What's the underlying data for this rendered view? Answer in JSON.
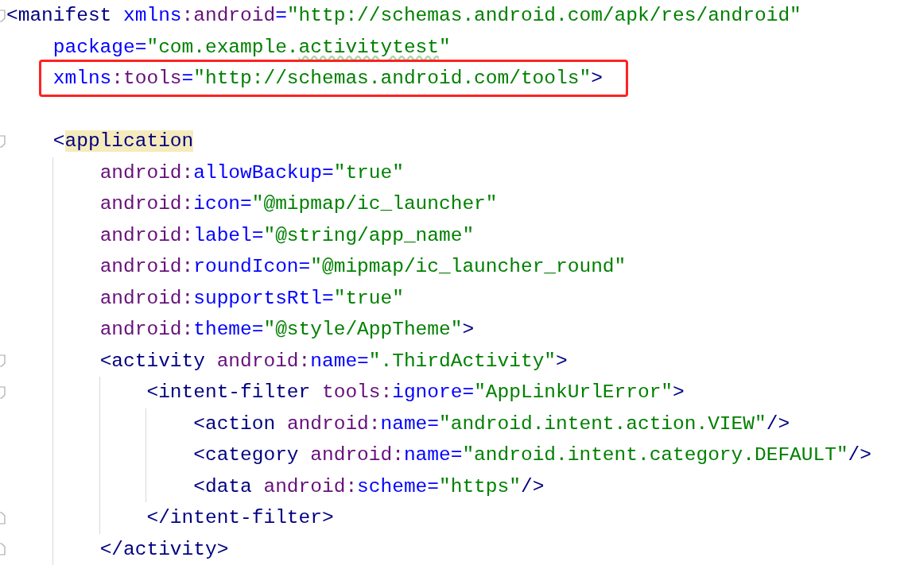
{
  "editor": {
    "lines": [
      {
        "kind": "fold-start",
        "tokens": [
          {
            "kind": "tag",
            "text": "<manifest "
          },
          {
            "kind": "attr",
            "text": "xmlns"
          },
          {
            "kind": "ns",
            "text": ":android"
          },
          {
            "kind": "attr",
            "text": "="
          },
          {
            "kind": "value",
            "text": "\"http://schemas.android.com/apk/res/android\""
          }
        ],
        "children": [
          {
            "kind": "plain",
            "tokens": [
              {
                "kind": "attr",
                "text": "package"
              },
              {
                "kind": "attr",
                "text": "="
              },
              {
                "kind": "value",
                "text": "\"com.example."
              },
              {
                "kind": "value",
                "text": "activitytest",
                "typo": true
              },
              {
                "kind": "value",
                "text": "\""
              }
            ]
          },
          {
            "kind": "plain",
            "boxed": true,
            "tokens": [
              {
                "kind": "attr",
                "text": "xmlns"
              },
              {
                "kind": "ns",
                "text": ":tools"
              },
              {
                "kind": "attr",
                "text": "="
              },
              {
                "kind": "value",
                "text": "\"http://schemas.android.com/tools\""
              },
              {
                "kind": "tag",
                "text": ">"
              }
            ]
          },
          {
            "kind": "blank"
          },
          {
            "kind": "fold-start",
            "tokens": [
              {
                "kind": "tag",
                "text": "<"
              },
              {
                "kind": "tag",
                "text": "application",
                "highlighted": true
              }
            ],
            "children": [
              {
                "kind": "plain",
                "tokens": [
                  {
                    "kind": "ns",
                    "text": "android:"
                  },
                  {
                    "kind": "attr",
                    "text": "allowBackup="
                  },
                  {
                    "kind": "value",
                    "text": "\"true\""
                  }
                ]
              },
              {
                "kind": "plain",
                "tokens": [
                  {
                    "kind": "ns",
                    "text": "android:"
                  },
                  {
                    "kind": "attr",
                    "text": "icon="
                  },
                  {
                    "kind": "value",
                    "text": "\"@mipmap/ic_launcher\""
                  }
                ]
              },
              {
                "kind": "plain",
                "tokens": [
                  {
                    "kind": "ns",
                    "text": "android:"
                  },
                  {
                    "kind": "attr",
                    "text": "label="
                  },
                  {
                    "kind": "value",
                    "text": "\"@string/app_name\""
                  }
                ]
              },
              {
                "kind": "plain",
                "tokens": [
                  {
                    "kind": "ns",
                    "text": "android:"
                  },
                  {
                    "kind": "attr",
                    "text": "roundIcon="
                  },
                  {
                    "kind": "value",
                    "text": "\"@mipmap/ic_launcher_round\""
                  }
                ]
              },
              {
                "kind": "plain",
                "tokens": [
                  {
                    "kind": "ns",
                    "text": "android:"
                  },
                  {
                    "kind": "attr",
                    "text": "supportsRtl="
                  },
                  {
                    "kind": "value",
                    "text": "\"true\""
                  }
                ]
              },
              {
                "kind": "plain",
                "tokens": [
                  {
                    "kind": "ns",
                    "text": "android:"
                  },
                  {
                    "kind": "attr",
                    "text": "theme="
                  },
                  {
                    "kind": "value",
                    "text": "\"@style/AppTheme\""
                  },
                  {
                    "kind": "tag",
                    "text": ">"
                  }
                ]
              },
              {
                "kind": "fold-start",
                "tokens": [
                  {
                    "kind": "tag",
                    "text": "<activity "
                  },
                  {
                    "kind": "ns",
                    "text": "android:"
                  },
                  {
                    "kind": "attr",
                    "text": "name="
                  },
                  {
                    "kind": "value",
                    "text": "\".ThirdActivity\""
                  },
                  {
                    "kind": "tag",
                    "text": ">"
                  }
                ],
                "children": [
                  {
                    "kind": "fold-start",
                    "tokens": [
                      {
                        "kind": "tag",
                        "text": "<intent-filter "
                      },
                      {
                        "kind": "ns",
                        "text": "tools:"
                      },
                      {
                        "kind": "attr",
                        "text": "ignore="
                      },
                      {
                        "kind": "value",
                        "text": "\"AppLinkUrlError\""
                      },
                      {
                        "kind": "tag",
                        "text": ">"
                      }
                    ],
                    "children": [
                      {
                        "kind": "plain",
                        "tokens": [
                          {
                            "kind": "tag",
                            "text": "<action "
                          },
                          {
                            "kind": "ns",
                            "text": "android:"
                          },
                          {
                            "kind": "attr",
                            "text": "name="
                          },
                          {
                            "kind": "value",
                            "text": "\"android.intent.action.VIEW\""
                          },
                          {
                            "kind": "tag",
                            "text": "/>"
                          }
                        ]
                      },
                      {
                        "kind": "plain",
                        "tokens": [
                          {
                            "kind": "tag",
                            "text": "<category "
                          },
                          {
                            "kind": "ns",
                            "text": "android:"
                          },
                          {
                            "kind": "attr",
                            "text": "name="
                          },
                          {
                            "kind": "value",
                            "text": "\"android.intent.category.DEFAULT\""
                          },
                          {
                            "kind": "tag",
                            "text": "/>"
                          }
                        ]
                      },
                      {
                        "kind": "plain",
                        "tokens": [
                          {
                            "kind": "tag",
                            "text": "<data "
                          },
                          {
                            "kind": "ns",
                            "text": "android:"
                          },
                          {
                            "kind": "attr",
                            "text": "scheme="
                          },
                          {
                            "kind": "value",
                            "text": "\"https\""
                          },
                          {
                            "kind": "tag",
                            "text": "/>"
                          }
                        ]
                      }
                    ]
                  },
                  {
                    "kind": "fold-end",
                    "tokens": [
                      {
                        "kind": "tag",
                        "text": "</intent-filter>"
                      }
                    ]
                  }
                ]
              },
              {
                "kind": "fold-end",
                "tokens": [
                  {
                    "kind": "tag",
                    "text": "</activity>"
                  }
                ]
              }
            ]
          }
        ]
      }
    ]
  }
}
